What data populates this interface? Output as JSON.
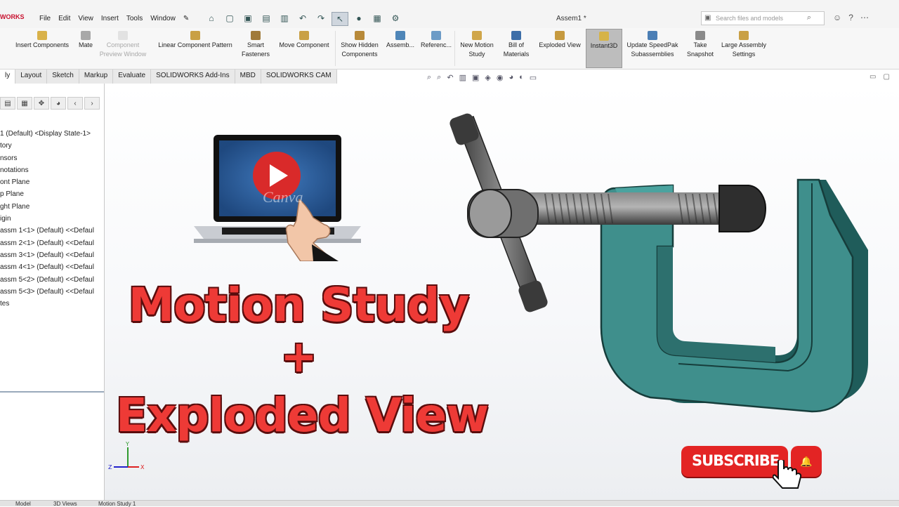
{
  "app": {
    "brand": "WORKS",
    "doc_title": "Assem1 *"
  },
  "menu": [
    "File",
    "Edit",
    "View",
    "Insert",
    "Tools",
    "Window"
  ],
  "search": {
    "placeholder": "Search files and models"
  },
  "ribbon": [
    {
      "label": "Insert Components",
      "icon": "insert-components-icon",
      "state": "normal"
    },
    {
      "label": "Mate",
      "icon": "mate-icon",
      "state": "normal"
    },
    {
      "label": "Component Preview Window",
      "icon": "preview-window-icon",
      "state": "disabled"
    },
    {
      "label": "Linear Component Pattern",
      "icon": "pattern-icon",
      "state": "normal"
    },
    {
      "label": "Smart Fasteners",
      "icon": "fastener-icon",
      "state": "normal"
    },
    {
      "label": "Move Component",
      "icon": "move-component-icon",
      "state": "normal"
    },
    {
      "label": "Show Hidden Components",
      "icon": "show-hidden-icon",
      "state": "normal"
    },
    {
      "label": "Assemb...",
      "icon": "assembly-features-icon",
      "state": "normal"
    },
    {
      "label": "Referenc...",
      "icon": "reference-geometry-icon",
      "state": "normal"
    },
    {
      "label": "New Motion Study",
      "icon": "motion-study-icon",
      "state": "normal"
    },
    {
      "label": "Bill of Materials",
      "icon": "bom-icon",
      "state": "normal"
    },
    {
      "label": "Exploded View",
      "icon": "exploded-view-icon",
      "state": "normal"
    },
    {
      "label": "Instant3D",
      "icon": "instant3d-icon",
      "state": "active"
    },
    {
      "label": "Update SpeedPak Subassemblies",
      "icon": "speedpak-icon",
      "state": "normal"
    },
    {
      "label": "Take Snapshot",
      "icon": "snapshot-icon",
      "state": "normal"
    },
    {
      "label": "Large Assembly Settings",
      "icon": "large-assembly-icon",
      "state": "normal"
    }
  ],
  "tabs": [
    "ly",
    "Layout",
    "Sketch",
    "Markup",
    "Evaluate",
    "SOLIDWORKS Add-Ins",
    "MBD",
    "SOLIDWORKS CAM"
  ],
  "tree": [
    "1 (Default) <Display State-1>",
    "tory",
    "nsors",
    "notations",
    "ont Plane",
    "p Plane",
    "ght Plane",
    "igin",
    "assm 1<1> (Default) <<Defaul",
    "assm 2<1> (Default) <<Defaul",
    "assm 3<1> (Default) <<Defaul",
    "assm 4<1> (Default) <<Defaul",
    "assm 5<2> (Default) <<Defaul",
    "assm 5<3> (Default) <<Defaul",
    "tes"
  ],
  "overlay": {
    "line1": "Motion Study",
    "line2": "+",
    "line3": "Exploded View",
    "subscribe": "SUBSCRIBE",
    "watermark": "Canva"
  },
  "triad": {
    "y": "Y",
    "z": "Z",
    "x": "X"
  },
  "bottom_tabs": [
    "Model",
    "3D Views",
    "Motion Study 1"
  ],
  "colors": {
    "headline": "#ee3a36",
    "clamp": "#3f8f8c",
    "subscribe": "#e32424",
    "active_button": "#bdbdbd"
  }
}
